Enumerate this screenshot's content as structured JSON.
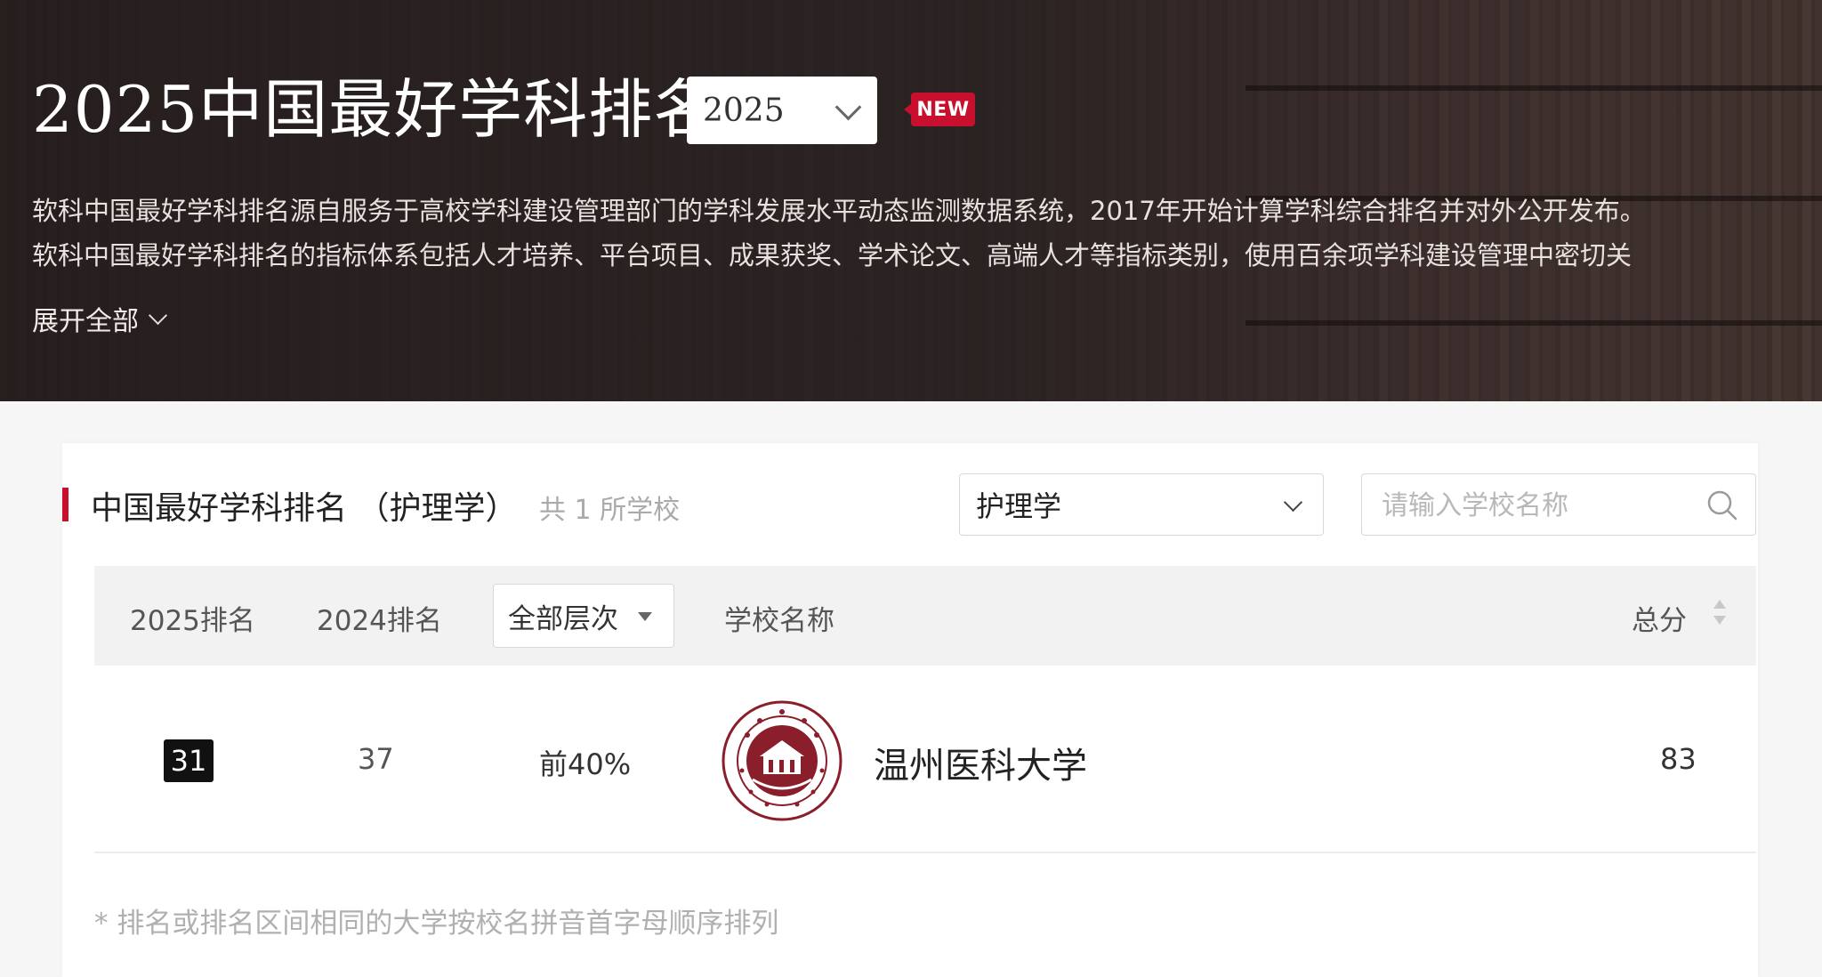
{
  "hero": {
    "title": "2025中国最好学科排名",
    "year_selected": "2025",
    "new_badge": "NEW",
    "description_line1": "软科中国最好学科排名源自服务于高校学科建设管理部门的学科发展水平动态监测数据系统，2017年开始计算学科综合排名并对外公开发布。",
    "description_line2": "软科中国最好学科排名的指标体系包括人才培养、平台项目、成果获奖、学术论文、高端人才等指标类别，使用百余项学科建设管理中密切关",
    "expand_label": "展开全部"
  },
  "section": {
    "title": "中国最好学科排名 （护理学）",
    "count_text": "共 1 所学校",
    "subject_selected": "护理学",
    "search_placeholder": "请输入学校名称",
    "search_value": ""
  },
  "table": {
    "headers": {
      "rank_2025": "2025排名",
      "rank_2024": "2024排名",
      "level_filter": "全部层次",
      "school_name": "学校名称",
      "total_score": "总分"
    },
    "rows": [
      {
        "rank_2025": "31",
        "rank_2024": "37",
        "level": "前40%",
        "school_name": "温州医科大学",
        "score": "83"
      }
    ]
  },
  "footnote": "* 排名或排名区间相同的大学按校名拼音首字母顺序排列",
  "colors": {
    "accent": "#c8102e",
    "hero_bg": "#2a2120",
    "school_logo": "#8b1e2b"
  },
  "icons": [
    "chevron-down-icon",
    "search-icon",
    "sort-icon",
    "caret-down-icon",
    "school-logo"
  ]
}
